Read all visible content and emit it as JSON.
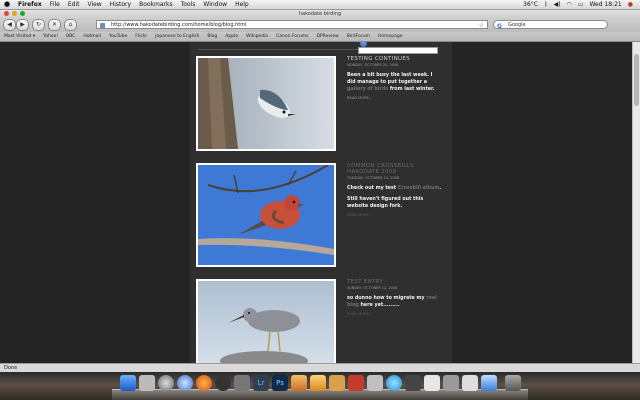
{
  "menubar": {
    "app": "Firefox",
    "items": [
      "File",
      "Edit",
      "View",
      "History",
      "Bookmarks",
      "Tools",
      "Window",
      "Help"
    ],
    "temperature": "36°C",
    "clock": "Wed 18:21"
  },
  "browser": {
    "window_title": "hakodate birding",
    "url": "http://www.hakodatebirding.com/home/blog/blog.html",
    "search_placeholder": "Google",
    "bookmarks": [
      "Most Visited ▾",
      "Yahoo!",
      "BBC",
      "Hotmail",
      "YouTube",
      "Flickr",
      "Japanese to English",
      "Blog",
      "Apple",
      "Wikipedia",
      "Canon Forums",
      "DPReview",
      "BirdForum",
      "Homepage"
    ],
    "status": "Done"
  },
  "posts": [
    {
      "title": "TESTING CONTINUES",
      "date": "MONDAY, OCTOBER 20, 2008",
      "body_1": "Been a bit busy the last week. I did manage to put together a ",
      "link": "gallery of birds",
      "body_2": " from last winter.",
      "more": "READ MORE..."
    },
    {
      "title": "COMMON CROSSBILLS HAKODATE 2008",
      "date": "TUESDAY, OCTOBER 14, 2008",
      "body_1": "Check out my test ",
      "link": "Crossbill album",
      "body_2": ".",
      "body_3": "Still haven't figured out this website design fork.",
      "more": "READ MORE..."
    },
    {
      "title": "TEST ENTRY",
      "date": "SUNDAY, OCTOBER 12, 2008",
      "body_1": "so dunno how to migrate my ",
      "link": "real blog",
      "body_2": " here yet.........",
      "more": "READ MORE..."
    }
  ]
}
